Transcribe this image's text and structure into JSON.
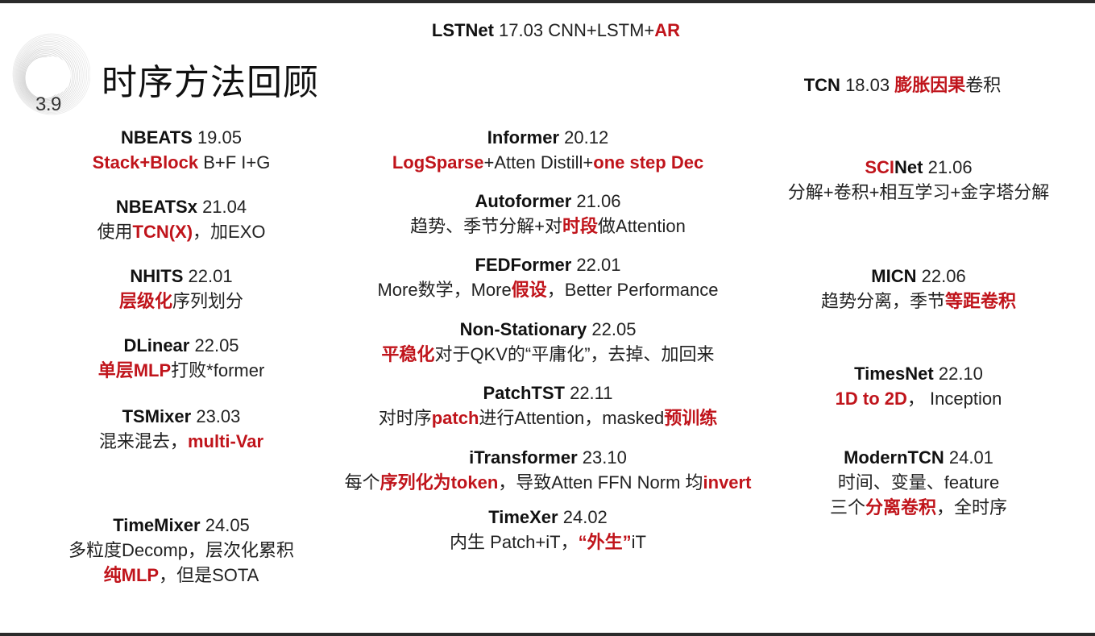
{
  "slide": {
    "section_number": "3.9",
    "title": "时序方法回顾"
  },
  "entries": {
    "lstnet": {
      "name": "LSTNet",
      "version": "17.03",
      "desc": [
        "CNN+LSTM+",
        "AR"
      ]
    },
    "tcn": {
      "name": "TCN",
      "version": "18.03",
      "desc": [
        "膨胀因果",
        "卷积"
      ]
    },
    "nbeats": {
      "name": "NBEATS",
      "version": "19.05",
      "desc": [
        "Stack+Block",
        " B+F I+G"
      ]
    },
    "nbeatsx": {
      "name": "NBEATSx",
      "version": "21.04",
      "desc": [
        "使用",
        "TCN(X)",
        "，加EXO"
      ]
    },
    "nhits": {
      "name": "NHITS",
      "version": "22.01",
      "desc": [
        "层级化",
        "序列划分"
      ]
    },
    "dlinear": {
      "name": "DLinear",
      "version": "22.05",
      "desc": [
        "单层MLP",
        "打败*former"
      ]
    },
    "tsmixer": {
      "name": "TSMixer",
      "version": "23.03",
      "desc": [
        "混来混去，",
        "multi-Var"
      ]
    },
    "timemixer": {
      "name": "TimeMixer",
      "version": "24.05",
      "desc1": "多粒度Decomp，层次化累积",
      "desc2": [
        "纯MLP",
        "，但是SOTA"
      ]
    },
    "informer": {
      "name": "Informer",
      "version": "20.12",
      "desc": [
        "LogSparse",
        "+Atten Distill+",
        "one step Dec"
      ]
    },
    "autoformer": {
      "name": "Autoformer",
      "version": "21.06",
      "desc": [
        "趋势、季节分解+对",
        "时段",
        "做Attention"
      ]
    },
    "fedformer": {
      "name": "FEDFormer",
      "version": "22.01",
      "desc": [
        "More数学，More",
        "假设",
        "，Better Performance"
      ]
    },
    "nonstationary": {
      "name": "Non-Stationary",
      "version": "22.05",
      "desc": [
        "平稳化",
        "对于QKV的“平庸化”，去掉、加回来"
      ]
    },
    "patchtst": {
      "name": "PatchTST",
      "version": "22.11",
      "desc": [
        "对时序",
        "patch",
        "进行Attention，masked",
        "预训练"
      ]
    },
    "itransformer": {
      "name": "iTransformer",
      "version": "23.10",
      "desc": [
        "每个",
        "序列化为token",
        "，导致Atten FFN Norm 均",
        "invert"
      ]
    },
    "timexer": {
      "name": "TimeXer",
      "version": "24.02",
      "desc": [
        "内生 Patch+iT，",
        "“外生”",
        "iT"
      ]
    },
    "scinet": {
      "name_hl": "SCI",
      "name": "Net",
      "version": "21.06",
      "desc": "分解+卷积+相互学习+金字塔分解"
    },
    "micn": {
      "name": "MICN",
      "version": "22.06",
      "desc": [
        "趋势分离，季节",
        "等距卷积"
      ]
    },
    "timesnet": {
      "name": "TimesNet",
      "version": "22.10",
      "desc": [
        "1D to 2D",
        "，  Inception"
      ]
    },
    "moderntcn": {
      "name": "ModernTCN",
      "version": "24.01",
      "desc1": "时间、变量、feature",
      "desc2": [
        "三个",
        "分离卷积",
        "，全时序"
      ]
    }
  },
  "colors": {
    "highlight": "#c0141b",
    "text": "#222222",
    "bars": "#2b2b2b"
  }
}
